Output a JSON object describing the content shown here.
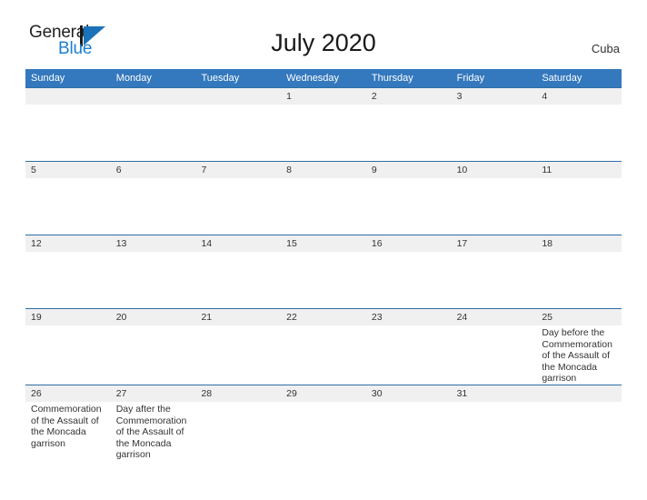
{
  "brand": {
    "name_part1": "General",
    "name_part2": "Blue",
    "logo_icon": "general-blue-triangle-logo"
  },
  "header": {
    "title": "July 2020",
    "country": "Cuba"
  },
  "colors": {
    "header_blue": "#3478bd",
    "row_border_blue": "#2e6da4",
    "day_band_gray": "#f0f0f0",
    "logo_blue": "#1c7fd0",
    "text": "#333333"
  },
  "calendar": {
    "day_headers": [
      "Sunday",
      "Monday",
      "Tuesday",
      "Wednesday",
      "Thursday",
      "Friday",
      "Saturday"
    ],
    "weeks": [
      [
        {
          "date": "",
          "events": []
        },
        {
          "date": "",
          "events": []
        },
        {
          "date": "",
          "events": []
        },
        {
          "date": "1",
          "events": []
        },
        {
          "date": "2",
          "events": []
        },
        {
          "date": "3",
          "events": []
        },
        {
          "date": "4",
          "events": []
        }
      ],
      [
        {
          "date": "5",
          "events": []
        },
        {
          "date": "6",
          "events": []
        },
        {
          "date": "7",
          "events": []
        },
        {
          "date": "8",
          "events": []
        },
        {
          "date": "9",
          "events": []
        },
        {
          "date": "10",
          "events": []
        },
        {
          "date": "11",
          "events": []
        }
      ],
      [
        {
          "date": "12",
          "events": []
        },
        {
          "date": "13",
          "events": []
        },
        {
          "date": "14",
          "events": []
        },
        {
          "date": "15",
          "events": []
        },
        {
          "date": "16",
          "events": []
        },
        {
          "date": "17",
          "events": []
        },
        {
          "date": "18",
          "events": []
        }
      ],
      [
        {
          "date": "19",
          "events": []
        },
        {
          "date": "20",
          "events": []
        },
        {
          "date": "21",
          "events": []
        },
        {
          "date": "22",
          "events": []
        },
        {
          "date": "23",
          "events": []
        },
        {
          "date": "24",
          "events": []
        },
        {
          "date": "25",
          "events": [
            "Day before the Commemoration of the Assault of the Moncada garrison"
          ]
        }
      ],
      [
        {
          "date": "26",
          "events": [
            "Commemoration of the Assault of the Moncada garrison"
          ]
        },
        {
          "date": "27",
          "events": [
            "Day after the Commemoration of the Assault of the Moncada garrison"
          ]
        },
        {
          "date": "28",
          "events": []
        },
        {
          "date": "29",
          "events": []
        },
        {
          "date": "30",
          "events": []
        },
        {
          "date": "31",
          "events": []
        },
        {
          "date": "",
          "events": []
        }
      ]
    ]
  }
}
